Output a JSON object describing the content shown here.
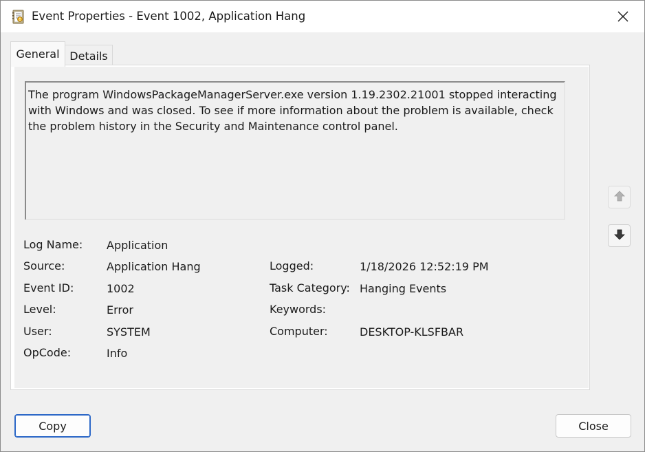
{
  "window": {
    "title": "Event Properties - Event 1002, Application Hang"
  },
  "icons": {
    "title_icon": "event-viewer-icon",
    "close": "close-icon",
    "up": "arrow-up-icon",
    "down": "arrow-down-icon"
  },
  "tabs": [
    {
      "label": "General",
      "active": true
    },
    {
      "label": "Details",
      "active": false
    }
  ],
  "description": "The program WindowsPackageManagerServer.exe version 1.19.2302.21001 stopped interacting with Windows and was closed. To see if more information about the problem is available, check the problem history in the Security and Maintenance control panel.",
  "fields": {
    "log_name": {
      "label": "Log Name:",
      "value": "Application"
    },
    "source": {
      "label": "Source:",
      "value": "Application Hang"
    },
    "logged": {
      "label": "Logged:",
      "value": "1/18/2026 12:52:19 PM"
    },
    "event_id": {
      "label": "Event ID:",
      "value": "1002"
    },
    "task_category": {
      "label": "Task Category:",
      "value": "Hanging Events"
    },
    "level": {
      "label": "Level:",
      "value": "Error"
    },
    "keywords": {
      "label": "Keywords:",
      "value": ""
    },
    "user": {
      "label": "User:",
      "value": "SYSTEM"
    },
    "computer": {
      "label": "Computer:",
      "value": "DESKTOP-KLSFBAR"
    },
    "opcode": {
      "label": "OpCode:",
      "value": "Info"
    }
  },
  "buttons": {
    "copy": "Copy",
    "close": "Close"
  },
  "colors": {
    "accent": "#2b67c7",
    "window_bg": "#f0f0f0"
  }
}
